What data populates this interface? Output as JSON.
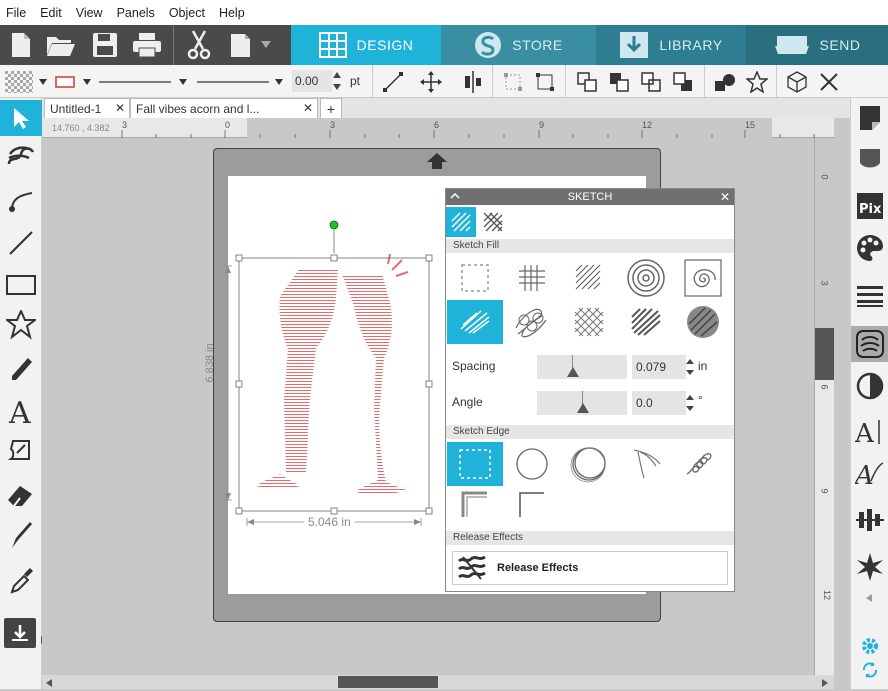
{
  "menu": [
    "File",
    "Edit",
    "View",
    "Panels",
    "Object",
    "Help"
  ],
  "main_tabs": [
    {
      "label": "DESIGN",
      "active": true
    },
    {
      "label": "STORE",
      "active": false
    },
    {
      "label": "LIBRARY",
      "active": false
    },
    {
      "label": "SEND",
      "active": false
    }
  ],
  "line_width": "0.00",
  "line_unit": "pt",
  "doc_tabs": [
    "Untitled-1",
    "Fall vibes acorn and l..."
  ],
  "coords": "14.760 , 4.382",
  "hruler_ticks": [
    "3",
    "0",
    "3",
    "6",
    "9",
    "12",
    "15"
  ],
  "vruler_ticks": [
    "0",
    "3",
    "6",
    "9",
    "12"
  ],
  "selection": {
    "height_label": "6.838 in",
    "width_label": "5.046 in"
  },
  "sketch": {
    "title": "SKETCH",
    "fill_section": "Sketch Fill",
    "spacing_label": "Spacing",
    "spacing_value": "0.079",
    "spacing_unit": "in",
    "angle_label": "Angle",
    "angle_value": "0.0",
    "angle_unit": "°",
    "edge_section": "Sketch Edge",
    "release_section": "Release Effects",
    "release_button": "Release Effects"
  },
  "colors": {
    "accent": "#1fb3d9",
    "toolbar": "#4a4a4a",
    "sketch_red": "#e86b6b"
  }
}
